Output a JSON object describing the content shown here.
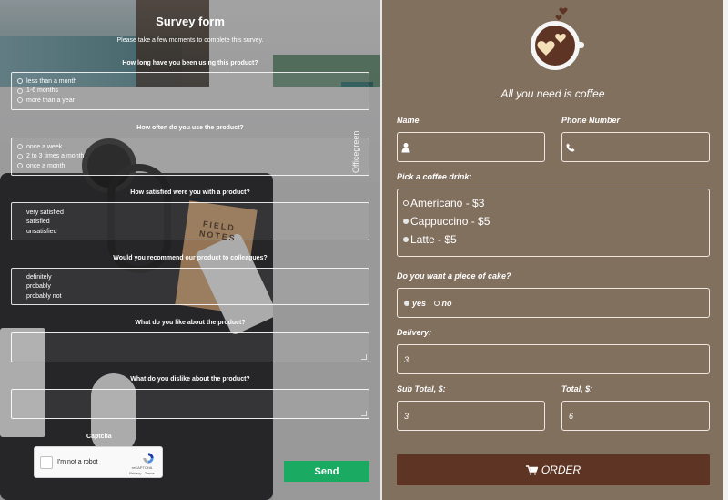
{
  "survey": {
    "title": "Survey form",
    "subtitle": "Please take a few moments to complete this survey.",
    "q1": {
      "question": "How long have you been using this product?",
      "options": [
        "less than a month",
        "1-6 months",
        "more than a year"
      ]
    },
    "q2": {
      "question": "How often do you use the product?",
      "options": [
        "once a week",
        "2 to 3 times a month",
        "once a month"
      ]
    },
    "q3": {
      "question": "How satisfied were you with a product?",
      "options": [
        "very satisfied",
        "satisfied",
        "unsatisfied"
      ]
    },
    "q4": {
      "question": "Would you recommend our product to colleagues?",
      "options": [
        "definitely",
        "probably",
        "probably not"
      ]
    },
    "q5": {
      "question": "What do you like about the product?"
    },
    "q6": {
      "question": "What do you dislike about the product?"
    },
    "captcha_label": "Captcha",
    "recaptcha": {
      "checkbox_text": "I'm not a robot",
      "brand": "reCAPTCHA",
      "links": "Privacy - Terms"
    },
    "send_label": "Send",
    "background_text": {
      "notebook": "FIELD NOTES",
      "book_spine": "Officegreen"
    },
    "accent_color": "#1aaa62"
  },
  "coffee": {
    "tagline": "All you need is coffee",
    "name_label": "Name",
    "phone_label": "Phone Number",
    "drink_label": "Pick a coffee drink:",
    "drinks": [
      "Americano - $3",
      "Cappuccino - $5",
      "Latte - $5"
    ],
    "cake_label": "Do you want a piece of cake?",
    "cake_options": [
      "yes",
      "no"
    ],
    "delivery_label": "Delivery:",
    "delivery_value": "3",
    "subtotal_label": "Sub Total, $:",
    "subtotal_value": "3",
    "total_label": "Total, $:",
    "total_value": "6",
    "order_label": "ORDER",
    "icons": {
      "name": "user-icon",
      "phone": "phone-icon",
      "order": "cart-icon",
      "logo": "coffee-cup-hearts-icon"
    },
    "background_color": "#82705f",
    "button_color": "#5e3525"
  }
}
